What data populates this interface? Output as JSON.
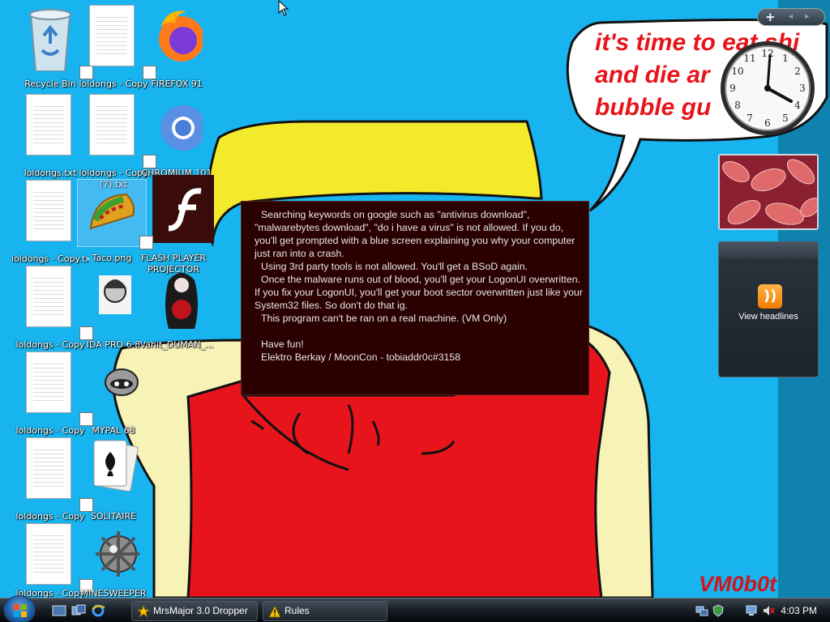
{
  "desktop": {
    "icons": [
      {
        "label": "Recycle Bin"
      },
      {
        "label": "loldongs - Copy"
      },
      {
        "label": "FIREFOX 91"
      },
      {
        "label": "loldongs.txt"
      },
      {
        "label": "loldongs - Copy (7).txt"
      },
      {
        "label": "CHROMIUM 101"
      },
      {
        "label": "loldongs - Copy.txt"
      },
      {
        "label": "Taco.png"
      },
      {
        "label": "FLASH PLAYER PROJECTOR"
      },
      {
        "label": "loldongs - Copy"
      },
      {
        "label": "IDA PRO 6.8"
      },
      {
        "label": "Vahit_DUMAN_..."
      },
      {
        "label": "loldongs - Copy"
      },
      {
        "label": "MYPAL 68"
      },
      {
        "label": "loldongs - Copy"
      },
      {
        "label": "SOLITAIRE"
      },
      {
        "label": "loldongs - Copy"
      },
      {
        "label": "MINESWEEPER"
      }
    ]
  },
  "wallpaper": {
    "bubble_lines": [
      "it's time to eat shi",
      "and die ar",
      "bubble gu"
    ],
    "signature": "VM0b0t"
  },
  "message": {
    "lines": [
      "Searching keywords on google such as \"antivirus download\", \"malwarebytes download\", \"do i have a virus\" is not allowed. If you do, you'll get prompted with a blue screen explaining you why your computer just ran into a crash.",
      "Using 3rd party tools is not allowed. You'll get a BSoD again.",
      "Once the malware runs out of blood, you'll get your LogonUI overwritten. If you fix your LogonUI, you'll get your boot sector overwritten just like your System32 files. So don't do that ig.",
      "This program can't be ran on a real machine. (VM Only)",
      "Have fun!",
      "Elektro Berkay / MoonCon - tobiaddr0c#3158"
    ]
  },
  "sidebar": {
    "add_label": "+",
    "nav_label": "◂ ▸",
    "feed_label": "View headlines"
  },
  "taskbar": {
    "buttons": [
      {
        "label": "MrsMajor 3.0 Dropper",
        "icon": "star-icon"
      },
      {
        "label": "Rules",
        "icon": "warning-icon"
      }
    ],
    "clock": "4:03 PM"
  },
  "colors": {
    "wallpaper_blue": "#17b4f0",
    "bubble_text": "#e8141c",
    "message_bg": "#2a0000"
  }
}
